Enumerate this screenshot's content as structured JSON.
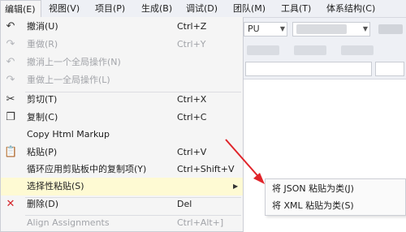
{
  "menubar": {
    "items": [
      "编辑(E)",
      "视图(V)",
      "项目(P)",
      "生成(B)",
      "调试(D)",
      "团队(M)",
      "工具(T)",
      "体系结构(C)"
    ]
  },
  "toolbar": {
    "combo_text": "PU"
  },
  "edit_menu": {
    "items": [
      {
        "label": "撤消(U)",
        "shortcut": "Ctrl+Z",
        "icon": "undo-icon",
        "enabled": true
      },
      {
        "label": "重做(R)",
        "shortcut": "Ctrl+Y",
        "icon": "redo-icon",
        "enabled": false
      },
      {
        "label": "撤消上一个全局操作(N)",
        "shortcut": "",
        "icon": "undo-global-icon",
        "enabled": false
      },
      {
        "label": "重做上一全局操作(L)",
        "shortcut": "",
        "icon": "redo-global-icon",
        "enabled": false
      },
      {
        "label": "剪切(T)",
        "shortcut": "Ctrl+X",
        "icon": "scissors-icon",
        "enabled": true
      },
      {
        "label": "复制(C)",
        "shortcut": "Ctrl+C",
        "icon": "copy-icon",
        "enabled": true
      },
      {
        "label": "Copy Html Markup",
        "shortcut": "",
        "icon": "",
        "enabled": true
      },
      {
        "label": "粘贴(P)",
        "shortcut": "Ctrl+V",
        "icon": "paste-icon",
        "enabled": true
      },
      {
        "label": "循环应用剪贴板中的复制项(Y)",
        "shortcut": "Ctrl+Shift+V",
        "icon": "",
        "enabled": true
      },
      {
        "label": "选择性粘贴(S)",
        "shortcut": "",
        "icon": "",
        "enabled": true
      },
      {
        "label": "删除(D)",
        "shortcut": "Del",
        "icon": "delete-icon",
        "enabled": true
      },
      {
        "label": "Align Assignments",
        "shortcut": "Ctrl+Alt+]",
        "icon": "",
        "enabled": false
      }
    ]
  },
  "paste_special_submenu": {
    "items": [
      "将 JSON 粘贴为类(J)",
      "将 XML 粘贴为类(S)"
    ]
  },
  "colors": {
    "highlight": "#fefad3",
    "arrow": "#e0242a",
    "delete_icon": "#d4262b"
  }
}
